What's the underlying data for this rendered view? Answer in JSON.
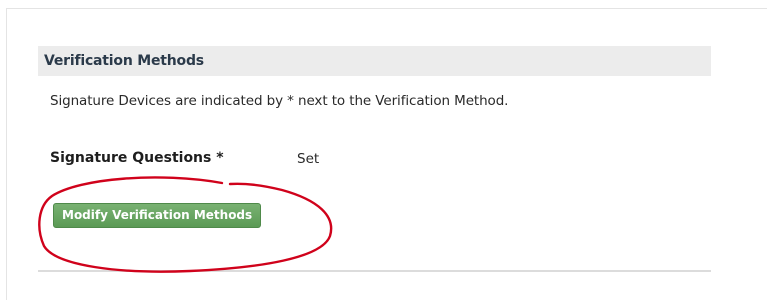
{
  "section": {
    "title": "Verification Methods",
    "help_text": "Signature Devices are indicated by * next to the Verification Method."
  },
  "methods": [
    {
      "label": "Signature Questions *",
      "status": "Set"
    }
  ],
  "actions": {
    "modify_label": "Modify Verification Methods"
  },
  "colors": {
    "button_green": "#5b9a55",
    "header_background": "#ececec",
    "annotation_red": "#d0021b"
  }
}
